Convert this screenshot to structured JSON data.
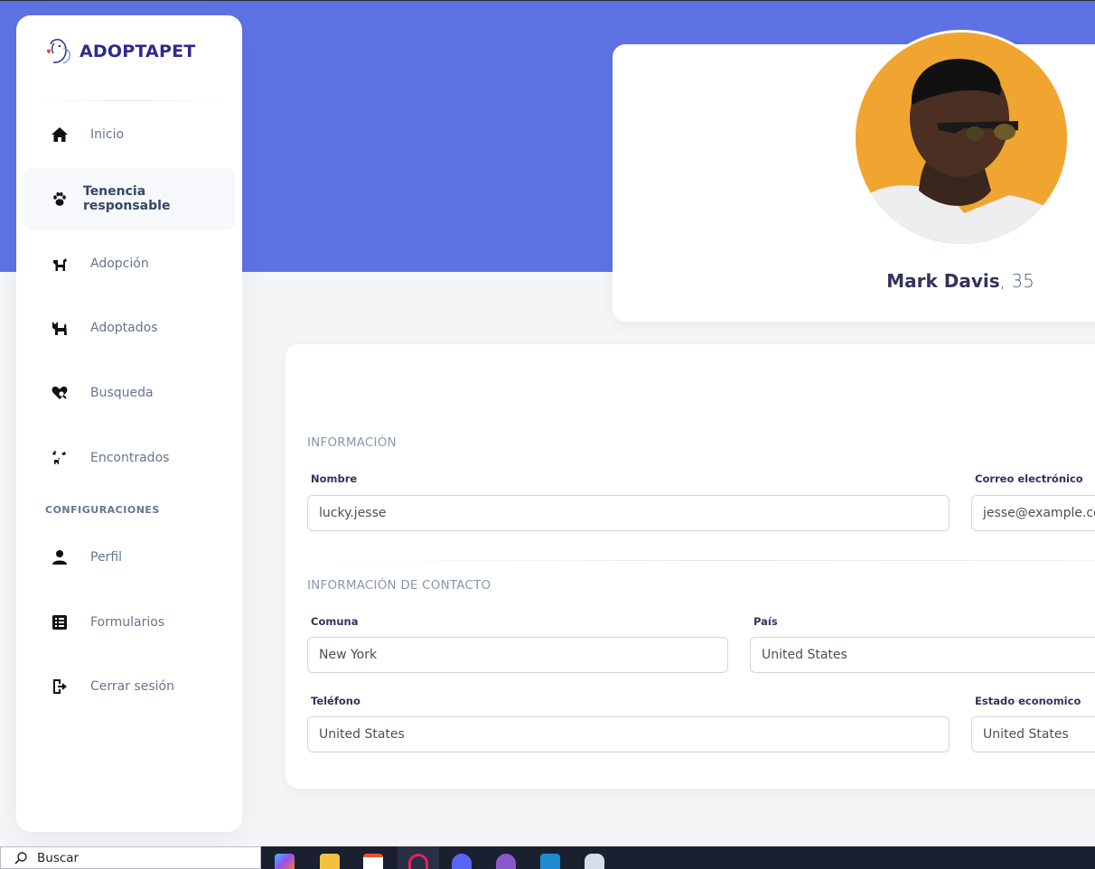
{
  "brand": {
    "name": "ADOPTAPET"
  },
  "sidebar": {
    "items": [
      {
        "label": "Inicio",
        "icon": "home-icon"
      },
      {
        "label": "Tenencia responsable",
        "icon": "paw-icon",
        "active": true
      },
      {
        "label": "Adopción",
        "icon": "dog-icon"
      },
      {
        "label": "Adoptados",
        "icon": "cat-icon"
      },
      {
        "label": "Busqueda",
        "icon": "heart-search-icon"
      },
      {
        "label": "Encontrados",
        "icon": "pets-found-icon"
      }
    ],
    "section_title": "CONFIGURACIONES",
    "config_items": [
      {
        "label": "Perfil",
        "icon": "user-icon"
      },
      {
        "label": "Formularios",
        "icon": "form-list-icon"
      },
      {
        "label": "Cerrar sesión",
        "icon": "logout-icon"
      }
    ]
  },
  "profile": {
    "name": "Mark Davis",
    "age": ", 35"
  },
  "form": {
    "info_heading": "INFORMACIÓN",
    "nombre_label": "Nombre",
    "nombre_value": "lucky.jesse",
    "correo_label": "Correo electrónico",
    "correo_value": "jesse@example.com",
    "contact_heading": "INFORMACIÓN DE CONTACTO",
    "comuna_label": "Comuna",
    "comuna_value": "New York",
    "pais_label": "País",
    "pais_value": "United States",
    "telefono_label": "Teléfono",
    "telefono_value": "United States",
    "estado_label": "Estado economico",
    "estado_value": "United States"
  },
  "taskbar": {
    "search_placeholder": "Buscar",
    "apps": [
      "copilot-icon",
      "file-explorer-icon",
      "microsoft-store-icon",
      "opera-icon",
      "discord-icon",
      "github-icon",
      "vscode-icon",
      "postgresql-icon"
    ]
  },
  "colors": {
    "hero": "#5e72e4",
    "brand_text": "#2e2a8c",
    "avatar_bg": "#f0a531"
  }
}
